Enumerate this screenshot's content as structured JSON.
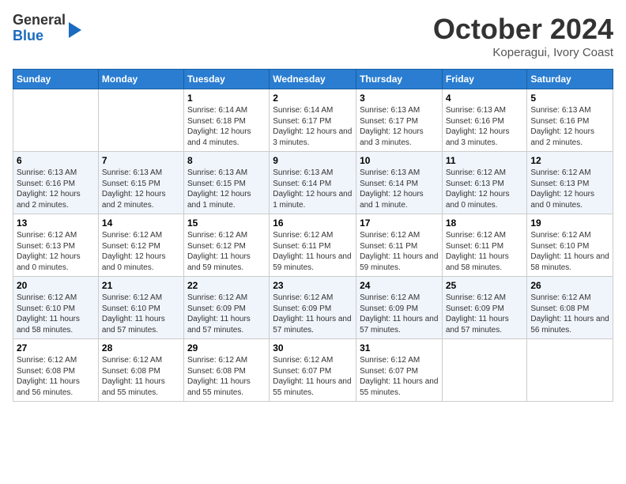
{
  "header": {
    "logo": {
      "line1": "General",
      "line2": "Blue"
    },
    "month_year": "October 2024",
    "location": "Koperagui, Ivory Coast"
  },
  "days_of_week": [
    "Sunday",
    "Monday",
    "Tuesday",
    "Wednesday",
    "Thursday",
    "Friday",
    "Saturday"
  ],
  "weeks": [
    [
      {
        "day": "",
        "info": ""
      },
      {
        "day": "",
        "info": ""
      },
      {
        "day": "1",
        "info": "Sunrise: 6:14 AM\nSunset: 6:18 PM\nDaylight: 12 hours and 4 minutes."
      },
      {
        "day": "2",
        "info": "Sunrise: 6:14 AM\nSunset: 6:17 PM\nDaylight: 12 hours and 3 minutes."
      },
      {
        "day": "3",
        "info": "Sunrise: 6:13 AM\nSunset: 6:17 PM\nDaylight: 12 hours and 3 minutes."
      },
      {
        "day": "4",
        "info": "Sunrise: 6:13 AM\nSunset: 6:16 PM\nDaylight: 12 hours and 3 minutes."
      },
      {
        "day": "5",
        "info": "Sunrise: 6:13 AM\nSunset: 6:16 PM\nDaylight: 12 hours and 2 minutes."
      }
    ],
    [
      {
        "day": "6",
        "info": "Sunrise: 6:13 AM\nSunset: 6:16 PM\nDaylight: 12 hours and 2 minutes."
      },
      {
        "day": "7",
        "info": "Sunrise: 6:13 AM\nSunset: 6:15 PM\nDaylight: 12 hours and 2 minutes."
      },
      {
        "day": "8",
        "info": "Sunrise: 6:13 AM\nSunset: 6:15 PM\nDaylight: 12 hours and 1 minute."
      },
      {
        "day": "9",
        "info": "Sunrise: 6:13 AM\nSunset: 6:14 PM\nDaylight: 12 hours and 1 minute."
      },
      {
        "day": "10",
        "info": "Sunrise: 6:13 AM\nSunset: 6:14 PM\nDaylight: 12 hours and 1 minute."
      },
      {
        "day": "11",
        "info": "Sunrise: 6:12 AM\nSunset: 6:13 PM\nDaylight: 12 hours and 0 minutes."
      },
      {
        "day": "12",
        "info": "Sunrise: 6:12 AM\nSunset: 6:13 PM\nDaylight: 12 hours and 0 minutes."
      }
    ],
    [
      {
        "day": "13",
        "info": "Sunrise: 6:12 AM\nSunset: 6:13 PM\nDaylight: 12 hours and 0 minutes."
      },
      {
        "day": "14",
        "info": "Sunrise: 6:12 AM\nSunset: 6:12 PM\nDaylight: 12 hours and 0 minutes."
      },
      {
        "day": "15",
        "info": "Sunrise: 6:12 AM\nSunset: 6:12 PM\nDaylight: 11 hours and 59 minutes."
      },
      {
        "day": "16",
        "info": "Sunrise: 6:12 AM\nSunset: 6:11 PM\nDaylight: 11 hours and 59 minutes."
      },
      {
        "day": "17",
        "info": "Sunrise: 6:12 AM\nSunset: 6:11 PM\nDaylight: 11 hours and 59 minutes."
      },
      {
        "day": "18",
        "info": "Sunrise: 6:12 AM\nSunset: 6:11 PM\nDaylight: 11 hours and 58 minutes."
      },
      {
        "day": "19",
        "info": "Sunrise: 6:12 AM\nSunset: 6:10 PM\nDaylight: 11 hours and 58 minutes."
      }
    ],
    [
      {
        "day": "20",
        "info": "Sunrise: 6:12 AM\nSunset: 6:10 PM\nDaylight: 11 hours and 58 minutes."
      },
      {
        "day": "21",
        "info": "Sunrise: 6:12 AM\nSunset: 6:10 PM\nDaylight: 11 hours and 57 minutes."
      },
      {
        "day": "22",
        "info": "Sunrise: 6:12 AM\nSunset: 6:09 PM\nDaylight: 11 hours and 57 minutes."
      },
      {
        "day": "23",
        "info": "Sunrise: 6:12 AM\nSunset: 6:09 PM\nDaylight: 11 hours and 57 minutes."
      },
      {
        "day": "24",
        "info": "Sunrise: 6:12 AM\nSunset: 6:09 PM\nDaylight: 11 hours and 57 minutes."
      },
      {
        "day": "25",
        "info": "Sunrise: 6:12 AM\nSunset: 6:09 PM\nDaylight: 11 hours and 57 minutes."
      },
      {
        "day": "26",
        "info": "Sunrise: 6:12 AM\nSunset: 6:08 PM\nDaylight: 11 hours and 56 minutes."
      }
    ],
    [
      {
        "day": "27",
        "info": "Sunrise: 6:12 AM\nSunset: 6:08 PM\nDaylight: 11 hours and 56 minutes."
      },
      {
        "day": "28",
        "info": "Sunrise: 6:12 AM\nSunset: 6:08 PM\nDaylight: 11 hours and 55 minutes."
      },
      {
        "day": "29",
        "info": "Sunrise: 6:12 AM\nSunset: 6:08 PM\nDaylight: 11 hours and 55 minutes."
      },
      {
        "day": "30",
        "info": "Sunrise: 6:12 AM\nSunset: 6:07 PM\nDaylight: 11 hours and 55 minutes."
      },
      {
        "day": "31",
        "info": "Sunrise: 6:12 AM\nSunset: 6:07 PM\nDaylight: 11 hours and 55 minutes."
      },
      {
        "day": "",
        "info": ""
      },
      {
        "day": "",
        "info": ""
      }
    ]
  ]
}
